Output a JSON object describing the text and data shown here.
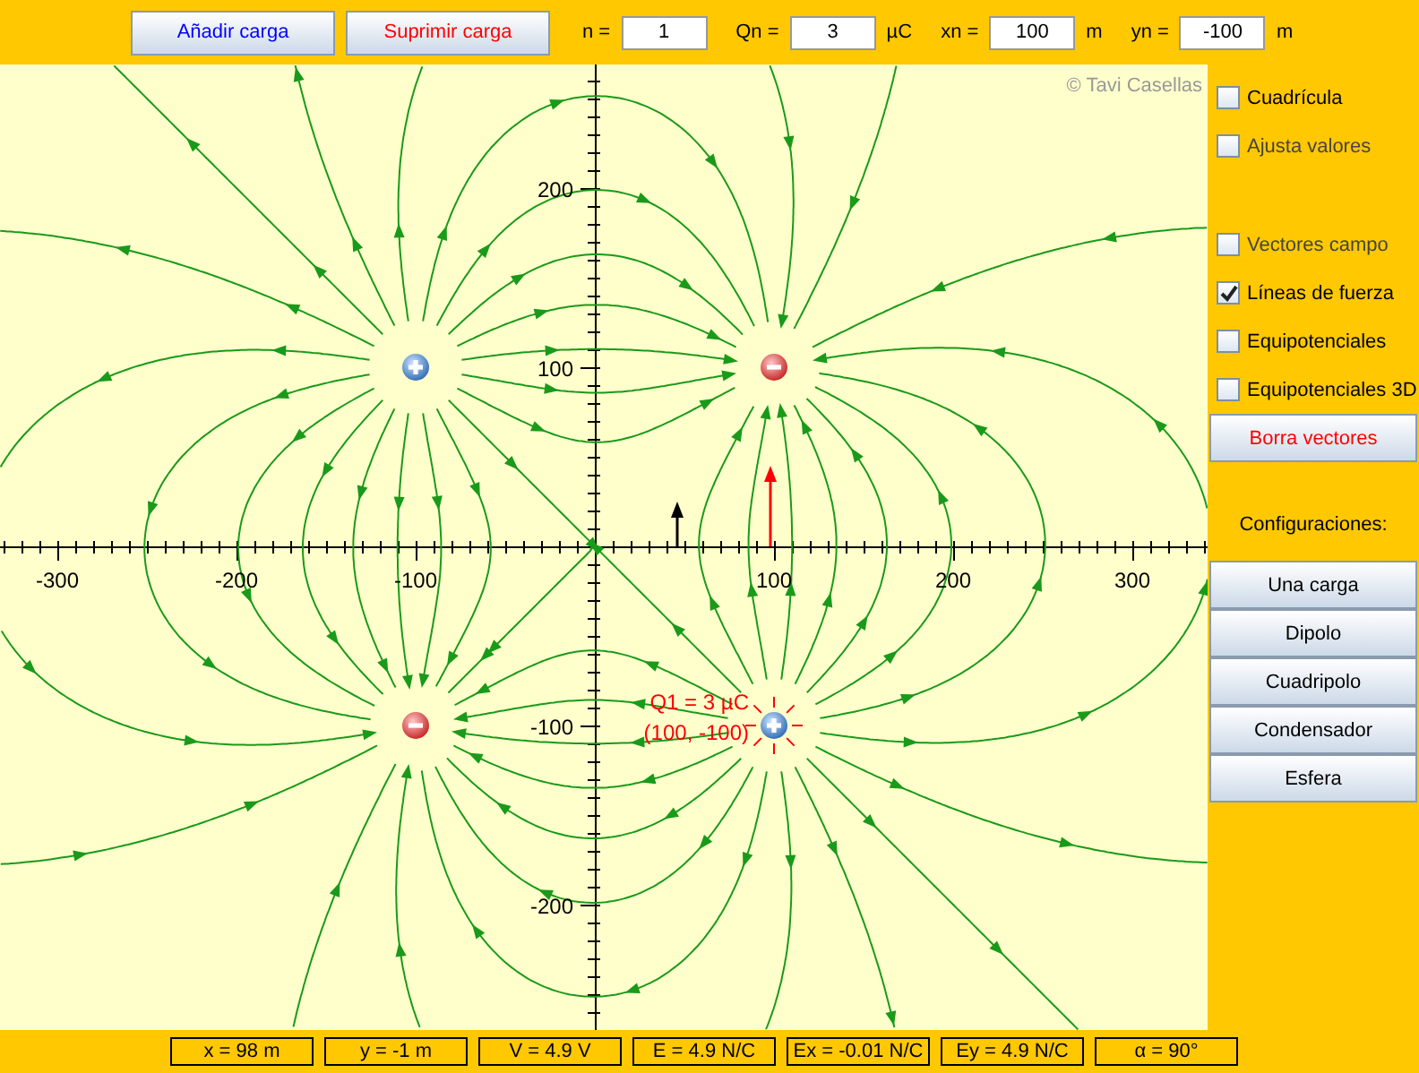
{
  "toolbar": {
    "buttons": [
      {
        "label": "Añadir carga",
        "kind": "add"
      },
      {
        "label": "Suprimir carga",
        "kind": "remove"
      }
    ],
    "fields": [
      {
        "label": "n =",
        "value": "1"
      },
      {
        "label": "Qn =",
        "value": "3",
        "unit": "µC"
      },
      {
        "label": "xn =",
        "value": "100",
        "unit": "m"
      },
      {
        "label": "yn =",
        "value": "-100",
        "unit": "m"
      }
    ]
  },
  "plot": {
    "credit": "© Tavi Casellas",
    "x_ticks": [
      "-300",
      "-200",
      "-100",
      "100",
      "200",
      "300"
    ],
    "y_ticks": [
      "200",
      "100",
      "-100",
      "-200"
    ],
    "charges": [
      {
        "kind": "positive",
        "selected": false
      },
      {
        "kind": "negative",
        "selected": false
      },
      {
        "kind": "negative",
        "selected": false
      },
      {
        "kind": "positive",
        "selected": true
      }
    ],
    "selected_label": [
      "Q1 = 3 µC",
      "(100, -100)"
    ],
    "vectors": [
      {
        "color": "#000000"
      },
      {
        "color": "#ff0000"
      }
    ]
  },
  "panel": {
    "display_options": [
      {
        "label": "Cuadrícula",
        "checked": false,
        "disabled": false
      },
      {
        "label": "Ajusta valores",
        "checked": false,
        "disabled": true
      }
    ],
    "field_options": [
      {
        "label": "Vectores campo",
        "checked": false,
        "disabled": true
      },
      {
        "label": "Líneas de fuerza",
        "checked": true,
        "disabled": false
      },
      {
        "label": "Equipotenciales",
        "checked": false,
        "disabled": false
      },
      {
        "label": "Equipotenciales 3D",
        "checked": false,
        "disabled": false
      }
    ],
    "clear_button": "Borra vectores",
    "configurations": {
      "title": "Configuraciones:",
      "buttons": [
        "Una carga",
        "Dipolo",
        "Cuadripolo",
        "Condensador",
        "Esfera"
      ]
    }
  },
  "status_bar": [
    "x = 98 m",
    "y = -1 m",
    "V = 4.9 V",
    "E = 4.9 N/C",
    "Ex = -0.01 N/C",
    "Ey = 4.9 N/C",
    "α = 90°"
  ]
}
